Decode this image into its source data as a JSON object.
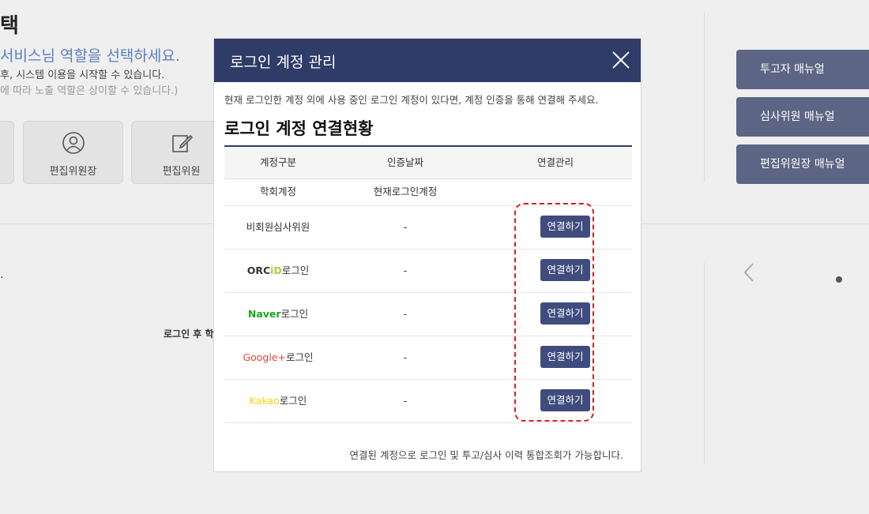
{
  "background": {
    "title": "택",
    "heading": "서비스님 역할을 선택하세요.",
    "desc1": "후, 시스템 이용을 시작할 수 있습니다.",
    "desc2": "에 따라 노출 역할은 상이할 수 있습니다.)",
    "role_cards": [
      {
        "label": "편집위원장"
      },
      {
        "label": "편집위원"
      }
    ],
    "dot_text": ".",
    "login_note": "로그인 후 학"
  },
  "manuals": [
    {
      "label": "투고자 매뉴얼"
    },
    {
      "label": "심사위원 매뉴얼"
    },
    {
      "label": "편집위원장 매뉴얼"
    }
  ],
  "modal": {
    "title": "로그인 계정 관리",
    "intro": "현재 로그인한 계정 외에 사용 중인 로그인 계정이 있다면, 계정 인증을 통해 연결해 주세요.",
    "section_title": "로그인 계정 연결현황",
    "columns": [
      "계정구분",
      "인증날짜",
      "연결관리"
    ],
    "rows": [
      {
        "type": "학회계정",
        "date": "현재로그인계정"
      },
      {
        "type": "비회원심사위원",
        "date": "-",
        "button": "연결하기"
      },
      {
        "type_a": "ORC",
        "type_b": "iD",
        "type_c": "로그인",
        "date": "-",
        "button": "연결하기"
      },
      {
        "type_a": "Naver",
        "type_c": "로그인",
        "date": "-",
        "button": "연결하기"
      },
      {
        "type_a": "Google+",
        "type_c": "로그인",
        "date": "-",
        "button": "연결하기"
      },
      {
        "type_a": "Kakao",
        "type_c": "로그인",
        "date": "-",
        "button": "연결하기"
      }
    ],
    "footer": "연결된 계정으로 로그인 및 투고/심사 이력 통합조회가 가능합니다.",
    "colors": {
      "header": "#2f3c68",
      "button": "#3f4c7d",
      "orcid_green": "#a6ce39",
      "naver": "#1ea51e",
      "google": "#dd4b39",
      "kakao": "#f7d300",
      "highlight": "#d42020"
    }
  }
}
